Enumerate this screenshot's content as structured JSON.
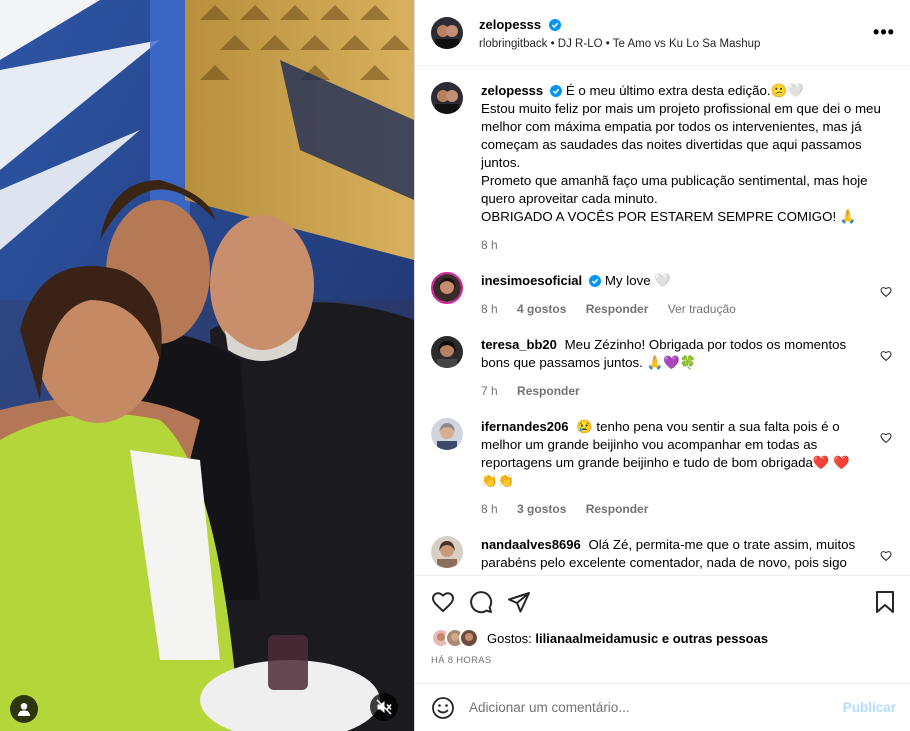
{
  "post": {
    "username": "zelopesss",
    "audio": "rlobringitback • DJ R-LO • Te Amo vs Ku Lo Sa Mashup",
    "caption_lines": [
      "É o meu último extra desta edição.😕🤍",
      "Estou muito feliz por mais um projeto profissional em que dei o meu melhor com máxima empatia por todos os intervenientes, mas já começam as saudades das noites divertidas que aqui passamos juntos.",
      "Prometo que amanhã faço uma publicação sentimental, mas hoje quero aproveitar cada minuto.",
      "OBRIGADO A VOCÊS POR ESTAREM SEMPRE COMIGO! 🙏"
    ],
    "caption_time": "8 h"
  },
  "comments": [
    {
      "user": "inesimoesoficial",
      "verified": true,
      "text": "My love 🤍",
      "time": "8 h",
      "likes": "4 gostos",
      "reply": "Responder",
      "translate": "Ver tradução"
    },
    {
      "user": "teresa_bb20",
      "verified": false,
      "text": "Meu Zézinho! Obrigada por todos os momentos bons que passamos juntos. 🙏💜🍀",
      "time": "7 h",
      "likes": "",
      "reply": "Responder",
      "translate": ""
    },
    {
      "user": "ifernandes206",
      "verified": false,
      "text": "😢 tenho pena vou sentir a sua falta pois é o melhor um grande beijinho vou acompanhar em todas as reportagens um grande beijinho e tudo de bom obrigada❤️ ❤️👏👏",
      "time": "8 h",
      "likes": "3 gostos",
      "reply": "Responder",
      "translate": ""
    },
    {
      "user": "nandaalves8696",
      "verified": false,
      "text": "Olá Zé, permita-me que o trate assim, muitos parabéns pelo excelente comentador, nada de novo, pois sigo",
      "time": "",
      "likes": "",
      "reply": "",
      "translate": ""
    }
  ],
  "likes_line": {
    "prefix": "Gostos:",
    "bold": "lilianaalmeidamusic e outras pessoas"
  },
  "posted_ago": "HÁ 8 HORAS",
  "add_comment": {
    "placeholder": "Adicionar um comentário...",
    "publish": "Publicar"
  },
  "colors": {
    "verified": "#0095f6",
    "link_disabled": "#b3dbff",
    "muted_text": "#737373",
    "jacket": "#b5d63a"
  },
  "icons": [
    "user-tag-icon",
    "mute-icon",
    "heart-icon",
    "comment-icon",
    "share-icon",
    "bookmark-icon",
    "emoji-icon",
    "more-icon",
    "verified-icon"
  ]
}
